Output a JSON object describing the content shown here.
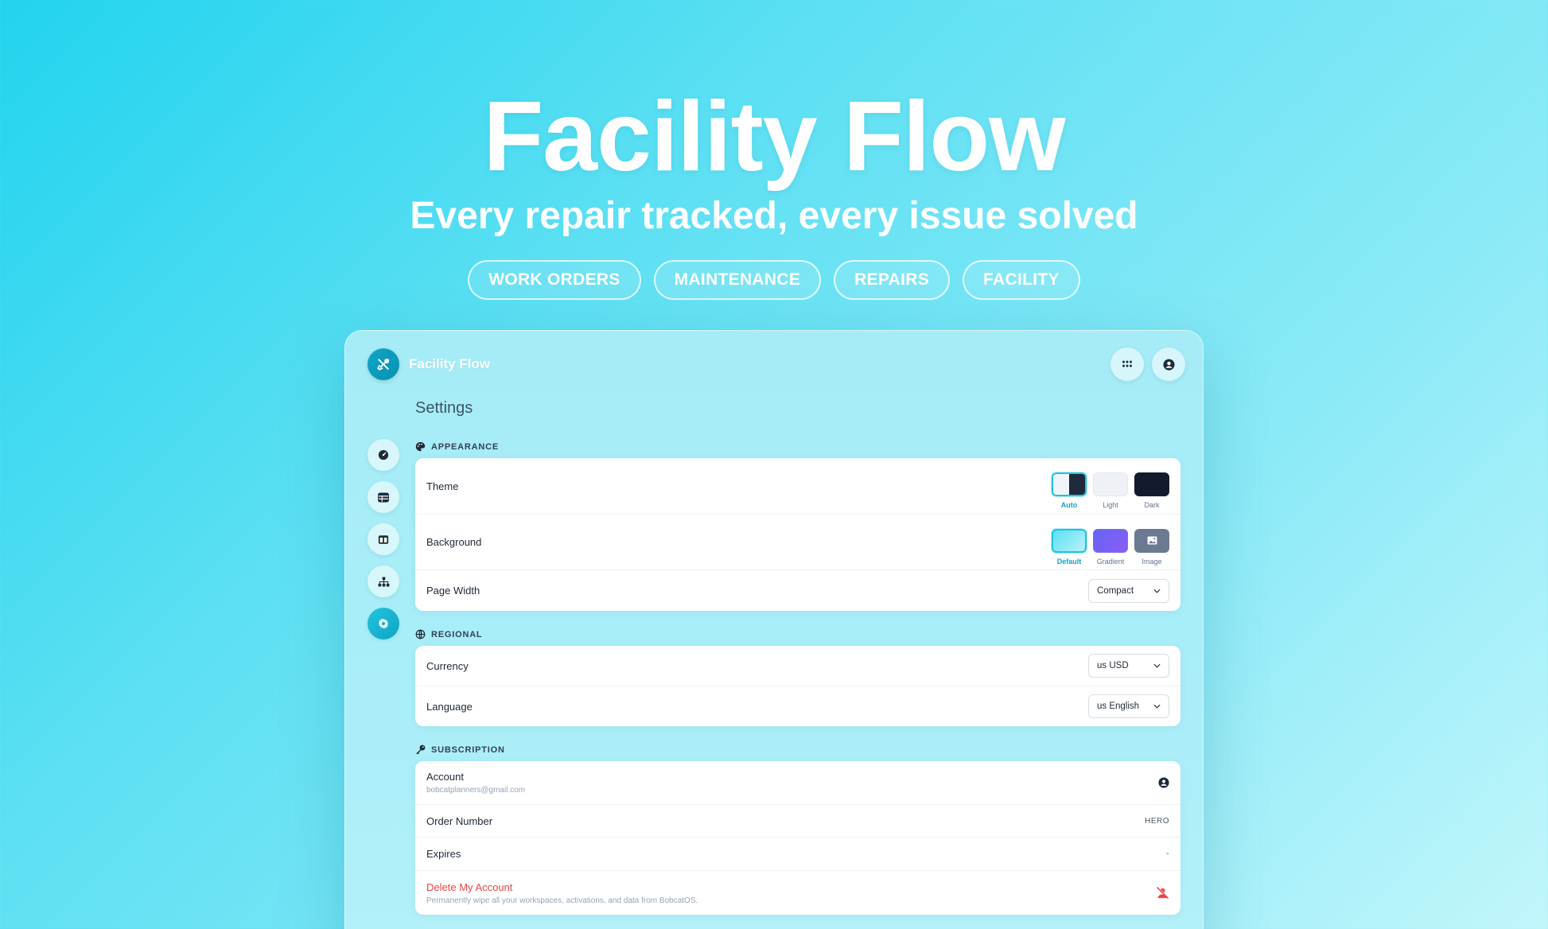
{
  "hero": {
    "title": "Facility Flow",
    "subtitle": "Every repair tracked, every issue solved",
    "tags": [
      "WORK ORDERS",
      "MAINTENANCE",
      "REPAIRS",
      "FACILITY"
    ]
  },
  "app": {
    "brand_name": "Facility Flow",
    "page_title": "Settings",
    "top_actions": [
      "apps-grid-icon",
      "account-circle-icon"
    ],
    "sidebar": [
      "dashboard-icon",
      "table-icon",
      "layout-icon",
      "hierarchy-icon",
      "settings-gear-icon"
    ],
    "active_sidebar": "settings-gear-icon"
  },
  "appearance": {
    "heading": "APPEARANCE",
    "theme": {
      "label": "Theme",
      "options": [
        "Auto",
        "Light",
        "Dark"
      ],
      "selected": "Auto"
    },
    "background": {
      "label": "Background",
      "options": [
        "Default",
        "Gradient",
        "Image"
      ],
      "selected": "Default"
    },
    "page_width": {
      "label": "Page Width",
      "value": "Compact"
    }
  },
  "regional": {
    "heading": "REGIONAL",
    "currency": {
      "label": "Currency",
      "value": "us USD"
    },
    "language": {
      "label": "Language",
      "value": "us English"
    }
  },
  "subscription": {
    "heading": "SUBSCRIPTION",
    "account": {
      "label": "Account",
      "email": "bobcatplanners@gmail.com"
    },
    "order_number": {
      "label": "Order Number",
      "value": "HERO"
    },
    "expires": {
      "label": "Expires",
      "value": "-"
    },
    "delete": {
      "label": "Delete My Account",
      "description": "Permanently wipe all your workspaces, activations, and data from BobcatOS."
    }
  },
  "colors": {
    "accent": "#22c3dd",
    "danger": "#ef4444",
    "page_bg_start": "#22d3ee",
    "page_bg_end": "#c2f6fb"
  }
}
